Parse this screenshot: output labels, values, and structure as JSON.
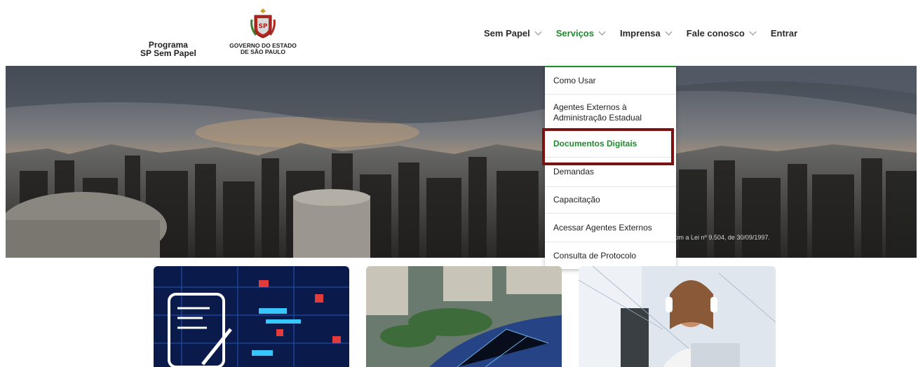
{
  "header": {
    "program_line1": "Programa",
    "program_line2": "SP Sem Papel",
    "gov_line1": "GOVERNO DO ESTADO",
    "gov_line2": "DE SÃO PAULO",
    "seal_icon": "sp-coat-of-arms-icon"
  },
  "nav": {
    "items": [
      {
        "label": "Sem Papel",
        "has_dropdown": true
      },
      {
        "label": "Serviços",
        "has_dropdown": true,
        "active": true
      },
      {
        "label": "Imprensa",
        "has_dropdown": true
      },
      {
        "label": "Fale conosco",
        "has_dropdown": true
      },
      {
        "label": "Entrar",
        "has_dropdown": false
      }
    ]
  },
  "dropdown": {
    "items": [
      {
        "label": "Como Usar"
      },
      {
        "label": "Agentes Externos à Administração Estadual"
      },
      {
        "label": "Documentos Digitais",
        "highlighted": true
      },
      {
        "label": "Demandas"
      },
      {
        "label": "Capacitação"
      },
      {
        "label": "Acessar Agentes Externos"
      },
      {
        "label": "Consulta de Protocolo"
      }
    ]
  },
  "hero": {
    "caption": "com a Lei nº 9.504, de 30/09/1997."
  },
  "colors": {
    "accent_green": "#1f8a2b",
    "highlight_box": "#7b1212"
  }
}
